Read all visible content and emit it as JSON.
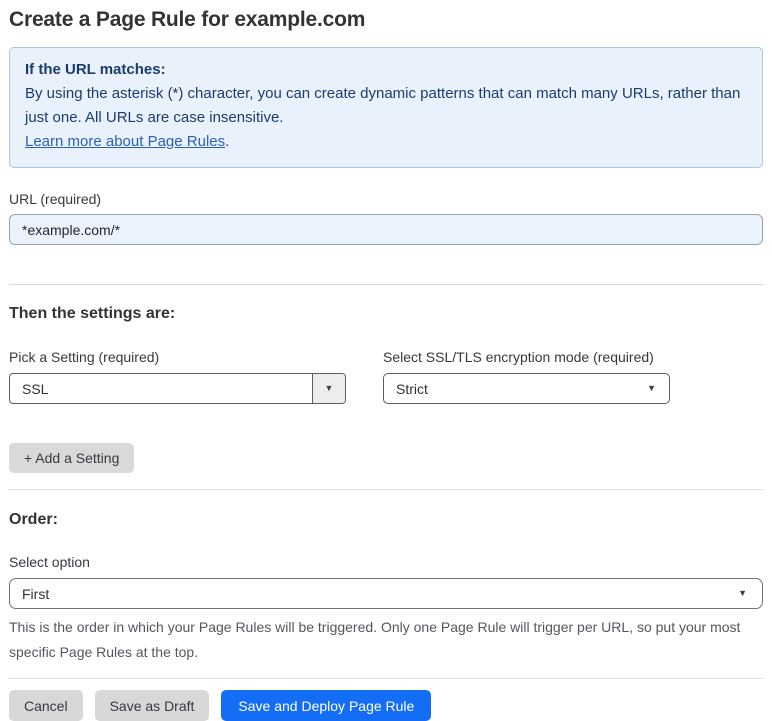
{
  "page": {
    "title": "Create a Page Rule for example.com"
  },
  "info_box": {
    "heading": "If the URL matches:",
    "body": "By using the asterisk (*) character, you can create dynamic patterns that can match many URLs, rather than just one. All URLs are case insensitive.",
    "link_text": "Learn more about Page Rules",
    "link_suffix": "."
  },
  "url_field": {
    "label": "URL (required)",
    "value": "*example.com/*"
  },
  "settings_section": {
    "heading": "Then the settings are:",
    "setting_picker": {
      "label": "Pick a Setting (required)",
      "selected": "SSL"
    },
    "ssl_mode_picker": {
      "label": "Select SSL/TLS encryption mode (required)",
      "selected": "Strict"
    },
    "add_setting_button": "+ Add a Setting"
  },
  "order_section": {
    "heading": "Order:",
    "label": "Select option",
    "selected": "First",
    "help_text": "This is the order in which your Page Rules will be triggered. Only one Page Rule will trigger per URL, so put your most specific Page Rules at the top."
  },
  "footer": {
    "cancel_label": "Cancel",
    "save_draft_label": "Save as Draft",
    "save_deploy_label": "Save and Deploy Page Rule"
  },
  "icons": {
    "dropdown_arrow": "▼"
  },
  "colors": {
    "accent_blue": "#146ef5",
    "info_box_bg": "#e9f2fc",
    "info_box_border": "#abc7e6",
    "info_text": "#1b3c6d",
    "link_blue": "#2a62ba",
    "url_input_bg": "#e9f2fd",
    "gray_button_bg": "#d8d8d9"
  }
}
